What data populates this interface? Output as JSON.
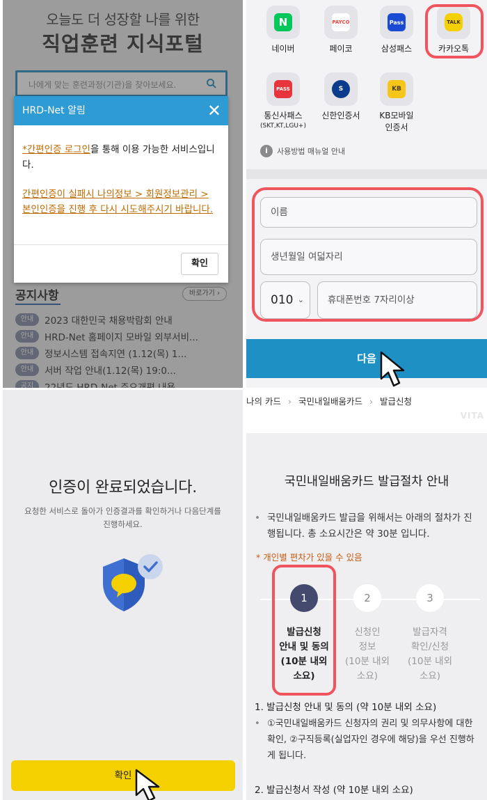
{
  "panel1": {
    "headline_top": "오늘도 더 성장할 나를 위한",
    "headline_main": "직업훈련 지식포털",
    "search_placeholder": "나에게 맞는 훈련과정(기관)을 찾아보세요.",
    "notice_title": "공지사항",
    "notice_more": "바로가기 ›",
    "notices": [
      {
        "tag": "안내",
        "text": "2023 대한민국 채용박람회 안내"
      },
      {
        "tag": "안내",
        "text": "HRD-Net 홈페이지 모바일 외부서비..."
      },
      {
        "tag": "안내",
        "text": "정보시스템 접속지연 (1.12(목) 1..."
      },
      {
        "tag": "안내",
        "text": "서버 작업 안내(1.12(목) 19:0..."
      },
      {
        "tag": "공지",
        "text": "22년도 HRD-Net 주요개편 내용 ..."
      }
    ],
    "modal": {
      "title": "HRD-Net 알림",
      "close": "✕",
      "line1_link": "*간편인증 로그인",
      "line1_rest": "을 통해 이용 가능한 서비스입니다.",
      "line2_link": "간편인증이 실패시 나의정보 > 회원정보관리 > 본인인증을 진행 후 다시 시도해주시기 바랍니다.",
      "ok": "확인"
    }
  },
  "panel2": {
    "apps_row1": [
      {
        "label": "네이버",
        "icon": "naver-icon",
        "glyph": "N",
        "color": "#03c75a"
      },
      {
        "label": "페이코",
        "icon": "payco-icon",
        "glyph": "PAYCO",
        "color": "#f2473f"
      },
      {
        "label": "삼성패스",
        "icon": "samsung-pass-icon",
        "glyph": "Pass",
        "color": "#1b4bd2"
      },
      {
        "label": "카카오톡",
        "icon": "kakaotalk-icon",
        "glyph": "TALK",
        "color": "#f5d000"
      }
    ],
    "apps_row2": [
      {
        "label": "통신사패스",
        "sub": "(SKT,KT,LGU+)",
        "icon": "telecom-pass-icon",
        "glyph": "PASS",
        "color": "#e8343c"
      },
      {
        "label": "신한인증서",
        "sub": "",
        "icon": "shinhan-cert-icon",
        "glyph": "S",
        "color": "#0a3b8c"
      },
      {
        "label": "KB모바일",
        "sub": "인증서",
        "icon": "kb-cert-icon",
        "glyph": "KB",
        "color": "#f5c518"
      }
    ],
    "info_text": "사용방법 매뉴얼 안내",
    "name_placeholder": "이름",
    "birth_placeholder": "생년월일 여덟자리",
    "carrier": "010",
    "phone_placeholder": "휴대폰번호 7자리이상",
    "next": "다음"
  },
  "panel3": {
    "title": "인증이 완료되었습니다.",
    "desc": "요청한 서비스로 돌아가 인증결과를 확인하거나 다음단계를 진행하세요.",
    "confirm": "확인"
  },
  "panel4": {
    "breadcrumb": [
      "나의 카드",
      "국민내일배움카드",
      "발급신청"
    ],
    "watermark": "VITA",
    "heading": "국민내일배움카드 발급절차 안내",
    "intro": "국민내일배움카드 발급을 위해서는 아래의 절차가 진행됩니다. 총 소요시간은 약 30분 입니다.",
    "warning": "* 개인별 편차가 있을 수 있음",
    "steps": [
      {
        "num": "1",
        "lines": [
          "발급신청",
          "안내 및 동의",
          "(10분 내외",
          "소요)"
        ]
      },
      {
        "num": "2",
        "lines": [
          "신청인",
          "정보",
          "(10분 내외",
          "소요)"
        ]
      },
      {
        "num": "3",
        "lines": [
          "발급자격",
          "확인/신청",
          "(10분 내외",
          "소요)"
        ]
      }
    ],
    "section1": "1. 발급신청 안내 및 동의 (약 10분 내외 소요)",
    "section1_detail": "①국민내일배움카드 신청자의 권리 및 의무사항에 대한 확인, ②구직등록(실업자인 경우에 해당)을 우선 진행하게 됩니다.",
    "section2": "2. 발급신청서 작성 (약 10분 내외 소요)"
  },
  "colors": {
    "hrd_blue": "#2e9bd5",
    "highlight_red": "#f0555e",
    "kakao_yellow": "#f5d000",
    "step_active": "#434a6e",
    "next_button": "#1f90c4"
  }
}
